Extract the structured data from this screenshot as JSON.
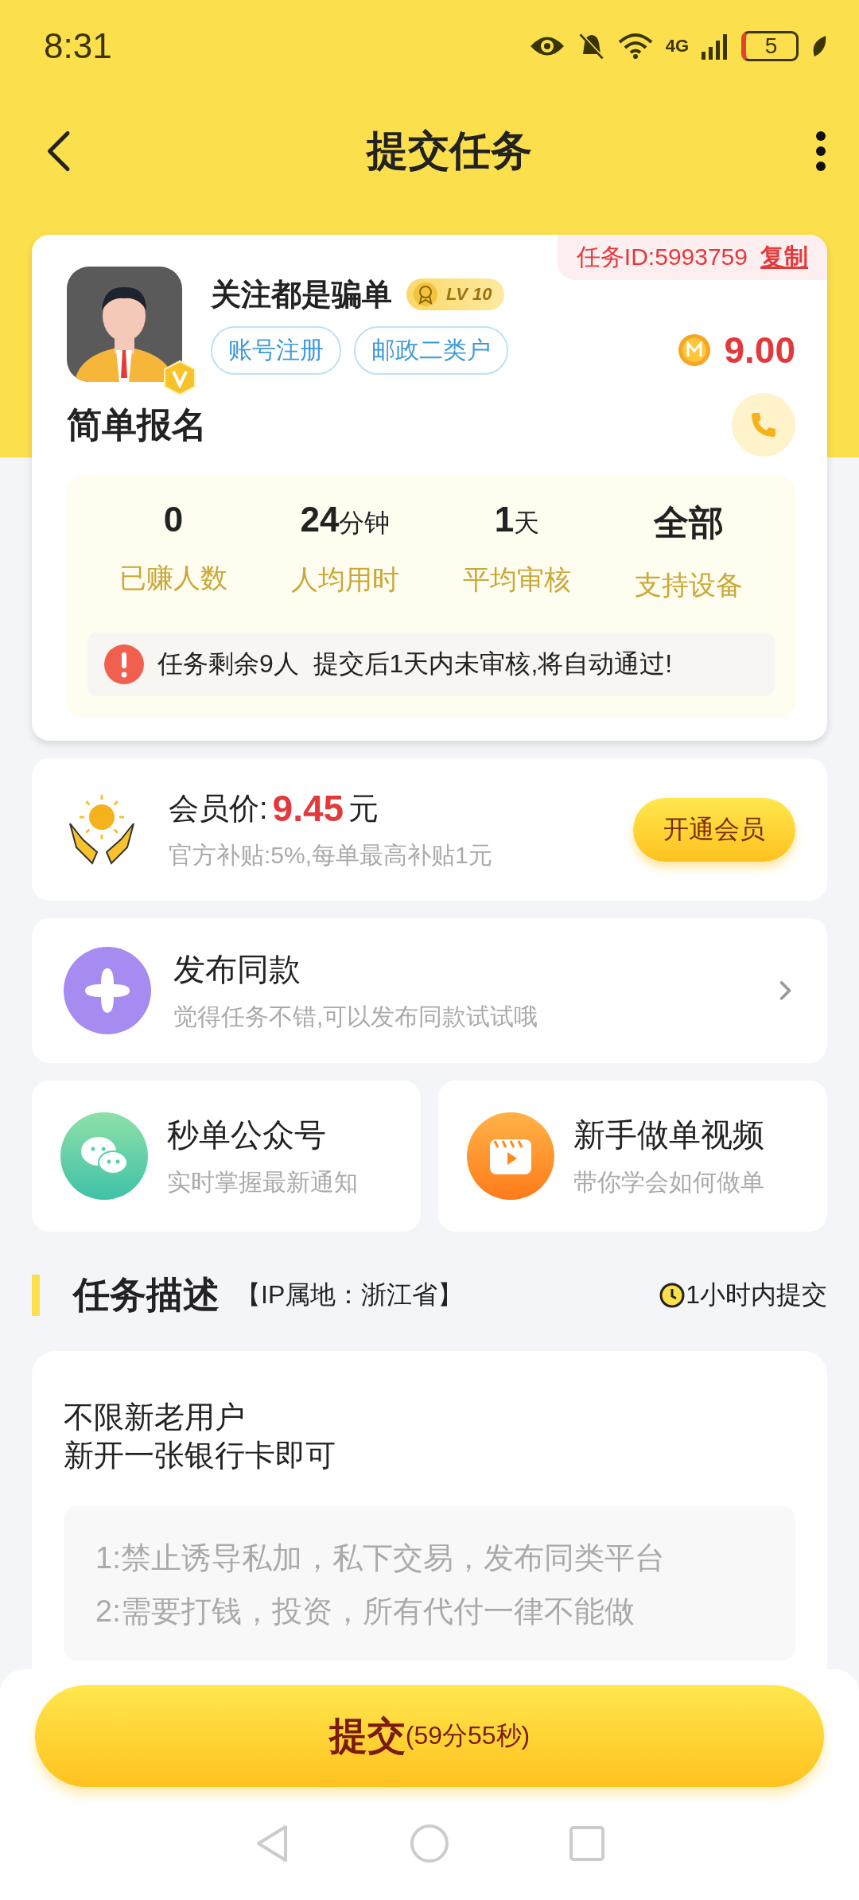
{
  "status_bar": {
    "time": "8:31",
    "network": "4G",
    "battery": "5"
  },
  "header": {
    "title": "提交任务"
  },
  "task": {
    "id_label": "任务ID:5993759",
    "copy_link": "复制",
    "publisher": "关注都是骗单",
    "level": "LV 10",
    "tags": [
      "账号注册",
      "邮政二类户"
    ],
    "reward": "9.00",
    "title": "简单报名",
    "stats": [
      {
        "value": "0",
        "label": "已赚人数"
      },
      {
        "value": "24",
        "unit": "分钟",
        "label": "人均用时"
      },
      {
        "value": "1",
        "unit": "天",
        "label": "平均审核"
      },
      {
        "value": "全部",
        "label": "支持设备"
      }
    ],
    "notice": "任务剩余9人  提交后1天内未审核,将自动通过!"
  },
  "membership": {
    "label": "会员价:",
    "price": "9.45",
    "unit": "元",
    "note": "官方补贴:5%,每单最高补贴1元",
    "button": "开通会员"
  },
  "publish": {
    "title": "发布同款",
    "subtitle": "觉得任务不错,可以发布同款试试哦"
  },
  "shortcuts": [
    {
      "kind": "wechat",
      "title": "秒单公众号",
      "subtitle": "实时掌握最新通知"
    },
    {
      "kind": "video",
      "title": "新手做单视频",
      "subtitle": "带你学会如何做单"
    }
  ],
  "description": {
    "title": "任务描述",
    "ip": "【IP属地：浙江省】",
    "deadline": "1小时内提交",
    "lines": [
      "不限新老用户",
      "新开一张银行卡即可"
    ],
    "rules": [
      "1:禁止诱导私加，私下交易，发布同类平台",
      "2:需要打钱，投资，所有代付一律不能做"
    ]
  },
  "submit": {
    "label": "提交",
    "countdown": "(59分55秒)"
  }
}
